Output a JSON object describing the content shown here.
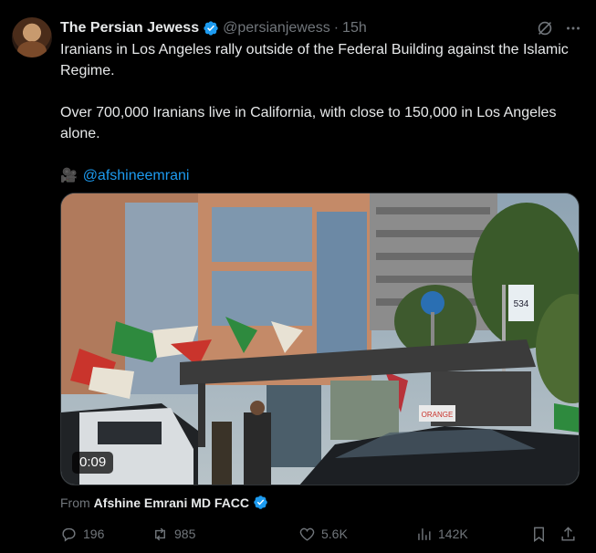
{
  "author": {
    "name": "The Persian Jewess",
    "handle": "@persianjewess",
    "separator": "·",
    "time": "15h"
  },
  "tweet": {
    "line1": "Iranians in Los Angeles rally outside of the Federal Building against the Islamic Regime.",
    "line2": "Over 700,000 Iranians live in California, with close to 150,000 in Los Angeles alone.",
    "credit_emoji": "🎥",
    "credit_mention": "@afshineemrani"
  },
  "media": {
    "duration": "0:09",
    "sign_number": "534",
    "banner_text": "ORANGE"
  },
  "from_line": {
    "prefix": "From",
    "source": "Afshine Emrani MD FACC"
  },
  "actions": {
    "replies": "196",
    "reposts": "985",
    "likes": "5.6K",
    "views": "142K"
  },
  "colors": {
    "background": "#000000",
    "text": "#e7e9ea",
    "muted": "#71767b",
    "accent": "#1d9bf0"
  },
  "icons": [
    "verified-badge-icon",
    "grok-icon",
    "more-icon",
    "reply-icon",
    "repost-icon",
    "like-icon",
    "views-icon",
    "bookmark-icon",
    "share-icon"
  ]
}
